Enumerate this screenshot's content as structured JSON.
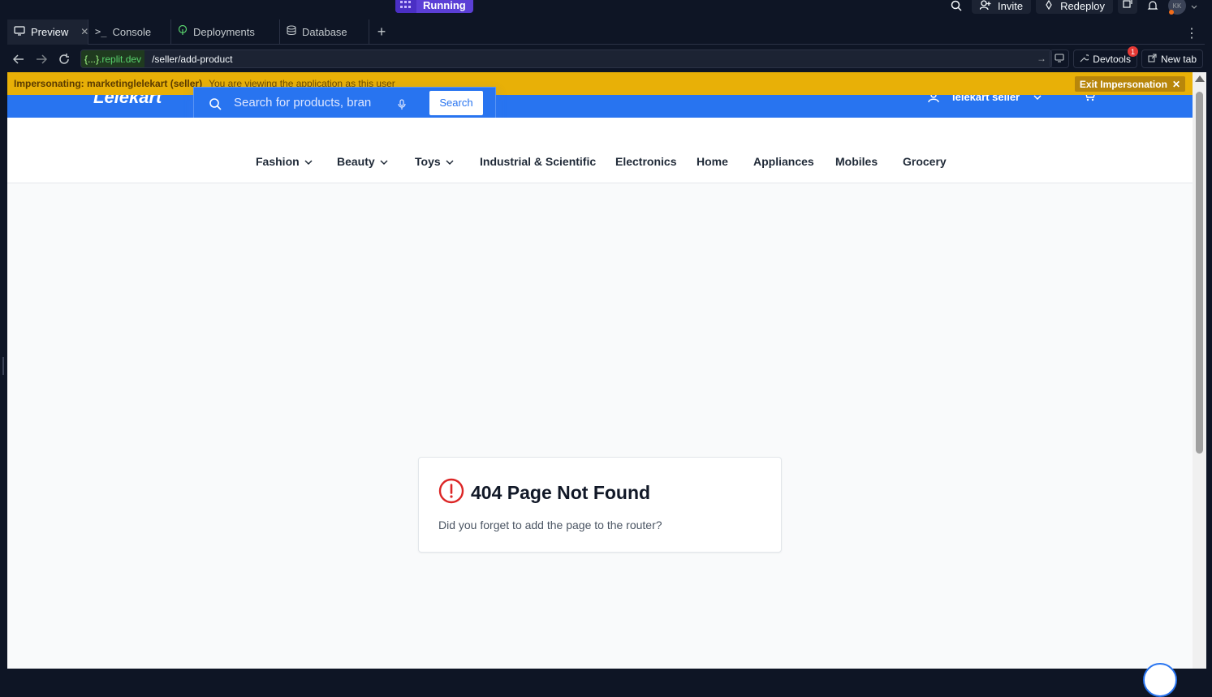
{
  "workspace": {
    "run_status": "Running",
    "invite_label": "Invite",
    "redeploy_label": "Redeploy",
    "avatar_initials": "KK"
  },
  "tabs": [
    {
      "label": "Preview",
      "icon": "monitor-icon",
      "active": true
    },
    {
      "label": "Console",
      "icon": "terminal-icon"
    },
    {
      "label": "Deployments",
      "icon": "deploy-icon"
    },
    {
      "label": "Database",
      "icon": "database-icon"
    }
  ],
  "urlbar": {
    "host_braces": "{...}",
    "host_domain": ".replit.dev",
    "path": "/seller/add-product",
    "devtools_label": "Devtools",
    "devtools_badge": "1",
    "new_tab_label": "New tab"
  },
  "impersonation": {
    "label": "Impersonating: marketinglelekart (seller)",
    "note": "You are viewing the application as this user",
    "exit_label": "Exit Impersonation"
  },
  "site": {
    "logo": "Lelekart",
    "search_placeholder": "Search for products, bran",
    "search_button": "Search",
    "user_label": "lelekart seller"
  },
  "categories": [
    {
      "label": "Fashion",
      "has_dropdown": true
    },
    {
      "label": "Beauty",
      "has_dropdown": true
    },
    {
      "label": "Toys",
      "has_dropdown": true
    },
    {
      "label": "Industrial & Scientific",
      "has_dropdown": false
    },
    {
      "label": "Electronics",
      "has_dropdown": false
    },
    {
      "label": "Home",
      "has_dropdown": false
    },
    {
      "label": "Appliances",
      "has_dropdown": false
    },
    {
      "label": "Mobiles",
      "has_dropdown": false
    },
    {
      "label": "Grocery",
      "has_dropdown": false
    }
  ],
  "error_card": {
    "title": "404 Page Not Found",
    "message": "Did you forget to add the page to the router?",
    "icon": "alert-circle-icon"
  },
  "colors": {
    "brand_blue": "#2874f0",
    "impersonation_yellow": "#e8b007",
    "error_red": "#dc2626",
    "run_purple": "#5b3fd6"
  }
}
